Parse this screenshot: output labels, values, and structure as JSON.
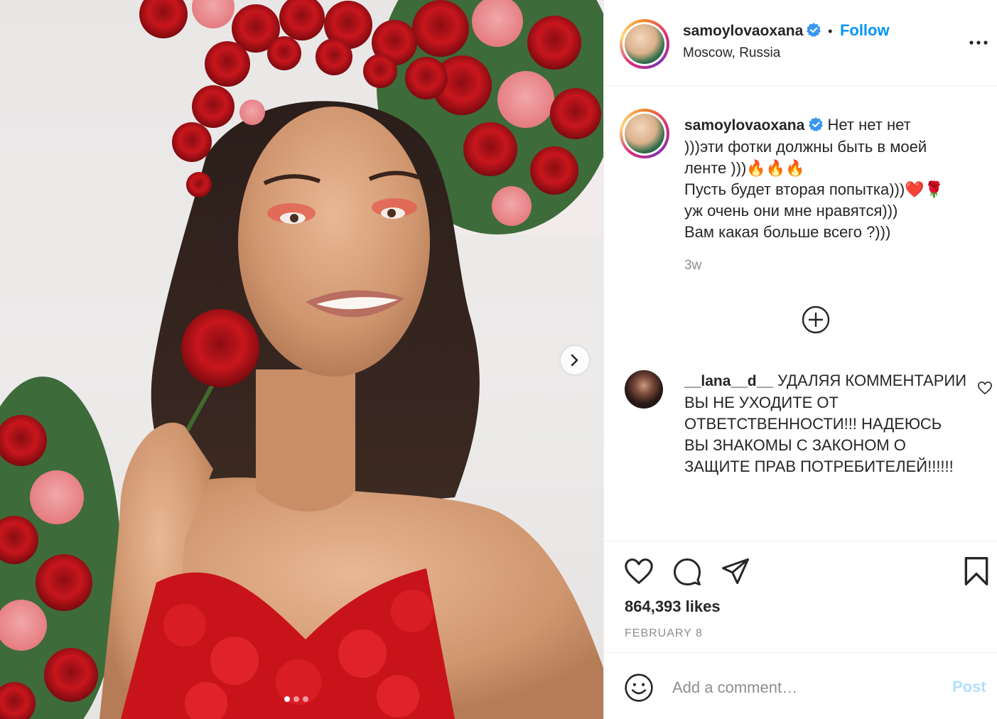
{
  "post": {
    "photo_alt": "",
    "carousel_count": 3,
    "carousel_active": 1
  },
  "header": {
    "username": "samoylovaoxana",
    "separator": "•",
    "follow_label": "Follow",
    "location": "Moscow, Russia"
  },
  "caption": {
    "username": "samoylovaoxana",
    "lines": [
      "Нет нет нет",
      ")))эти фотки должны быть в моей",
      "ленте )))🔥🔥🔥",
      "Пусть будет вторая попытка)))❤️🌹",
      "уж очень они мне нравятся)))",
      "Вам какая больше всего ?)))"
    ],
    "time": "3w"
  },
  "comment": {
    "username": "__lana__d__",
    "text": "УДАЛЯЯ КОММЕНТАРИИ ВЫ НЕ УХОДИТЕ ОТ ОТВЕТСТВЕННОСТИ!!! НАДЕЮСЬ ВЫ ЗНАКОМЫ С ЗАКОНОМ О ЗАЩИТЕ ПРАВ ПОТРЕБИТЕЛЕЙ!!!!!!"
  },
  "stats": {
    "likes": "864,393 likes",
    "date": "FEBRUARY 8"
  },
  "add_comment": {
    "placeholder": "Add a comment…",
    "post_label": "Post"
  },
  "colors": {
    "link_blue": "#0095f6",
    "post_disabled": "#b2dffc",
    "muted": "#8e8e8e",
    "verified": "#3897f0"
  },
  "icons": [
    "verified-badge-icon",
    "more-options-icon",
    "load-more-icon",
    "heart-icon",
    "comment-icon",
    "share-icon",
    "bookmark-icon",
    "emoji-icon",
    "chevron-right-icon"
  ]
}
